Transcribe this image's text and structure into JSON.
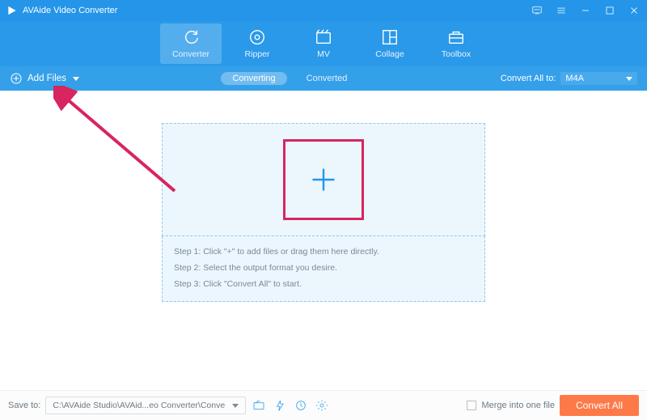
{
  "title": "AVAide Video Converter",
  "nav": {
    "converter": "Converter",
    "ripper": "Ripper",
    "mv": "MV",
    "collage": "Collage",
    "toolbox": "Toolbox"
  },
  "toolbar": {
    "add_files": "Add Files",
    "tab_converting": "Converting",
    "tab_converted": "Converted",
    "convert_all_to": "Convert All to:",
    "format_value": "M4A"
  },
  "steps": {
    "s1": "Step 1: Click \"+\" to add files or drag them here directly.",
    "s2": "Step 2: Select the output format you desire.",
    "s3": "Step 3: Click \"Convert All\" to start."
  },
  "footer": {
    "save_to_label": "Save to:",
    "save_to_path": "C:\\AVAide Studio\\AVAid...eo Converter\\Converted",
    "merge_label": "Merge into one file",
    "convert_all": "Convert All"
  }
}
